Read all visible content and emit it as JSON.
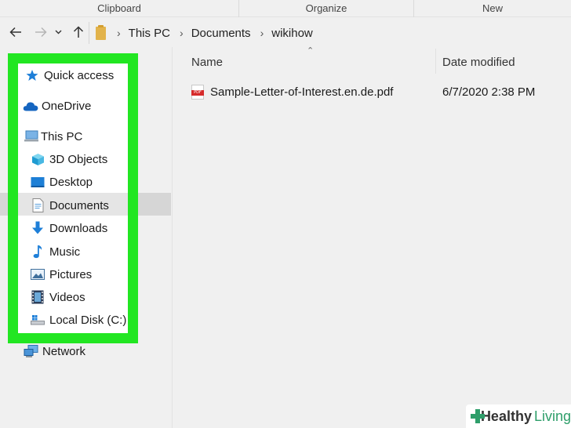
{
  "ribbon": {
    "groups": [
      "Clipboard",
      "Organize",
      "New"
    ]
  },
  "navigation": {
    "back_icon": "arrow-left-icon",
    "forward_icon": "arrow-right-icon",
    "recent_icon": "chevron-down-icon",
    "up_icon": "arrow-up-icon"
  },
  "address": {
    "crumbs": [
      "This PC",
      "Documents",
      "wikihow"
    ]
  },
  "sidebar": {
    "highlight_color": "#22e622",
    "items": [
      {
        "label": "Quick access",
        "icon": "star-icon"
      },
      {
        "label": "OneDrive",
        "icon": "cloud-icon"
      },
      {
        "label": "This PC",
        "icon": "computer-icon"
      },
      {
        "label": "3D Objects",
        "icon": "cube-icon"
      },
      {
        "label": "Desktop",
        "icon": "desktop-icon"
      },
      {
        "label": "Documents",
        "icon": "document-icon",
        "selected": true
      },
      {
        "label": "Downloads",
        "icon": "download-icon"
      },
      {
        "label": "Music",
        "icon": "music-note-icon"
      },
      {
        "label": "Pictures",
        "icon": "picture-icon"
      },
      {
        "label": "Videos",
        "icon": "video-icon"
      },
      {
        "label": "Local Disk (C:)",
        "icon": "drive-icon"
      },
      {
        "label": "Network",
        "icon": "network-icon"
      }
    ]
  },
  "content": {
    "columns": {
      "name": "Name",
      "date": "Date modified"
    },
    "files": [
      {
        "name": "Sample-Letter-of-Interest.en.de.pdf",
        "date": "6/7/2020 2:38 PM",
        "icon": "pdf-icon"
      }
    ]
  },
  "watermark": {
    "brand": "Healthy",
    "brand_suffix": "Living",
    "accent_color": "#2e9e6a"
  }
}
